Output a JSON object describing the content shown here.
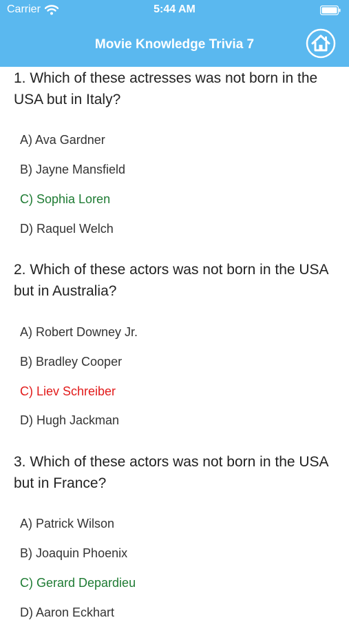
{
  "status_bar": {
    "carrier": "Carrier",
    "time": "5:44 AM",
    "wifi_icon": "wifi-icon",
    "battery_icon": "battery-icon"
  },
  "nav": {
    "title": "Movie Knowledge Trivia 7",
    "home_icon": "home-icon",
    "background_color": "#5ab8ef"
  },
  "colors": {
    "correct": "#1e7b33",
    "wrong": "#e21a1a",
    "default": "#333333"
  },
  "questions": [
    {
      "text": "1. Which of these actresses was not born in the USA but in Italy?",
      "answers": [
        {
          "label": "A) Ava Gardner",
          "state": "default"
        },
        {
          "label": "B) Jayne Mansfield",
          "state": "default"
        },
        {
          "label": "C) Sophia Loren",
          "state": "correct"
        },
        {
          "label": "D) Raquel Welch",
          "state": "default"
        }
      ]
    },
    {
      "text": "2. Which of these actors was not born in the USA but in Australia?",
      "answers": [
        {
          "label": "A) Robert Downey Jr.",
          "state": "default"
        },
        {
          "label": "B) Bradley Cooper",
          "state": "default"
        },
        {
          "label": "C) Liev Schreiber",
          "state": "wrong"
        },
        {
          "label": "D) Hugh Jackman",
          "state": "default"
        }
      ]
    },
    {
      "text": "3. Which of these actors was not born in the USA but in France?",
      "answers": [
        {
          "label": "A) Patrick Wilson",
          "state": "default"
        },
        {
          "label": "B) Joaquin Phoenix",
          "state": "default"
        },
        {
          "label": "C) Gerard Depardieu",
          "state": "correct"
        },
        {
          "label": "D) Aaron Eckhart",
          "state": "default"
        }
      ]
    }
  ]
}
